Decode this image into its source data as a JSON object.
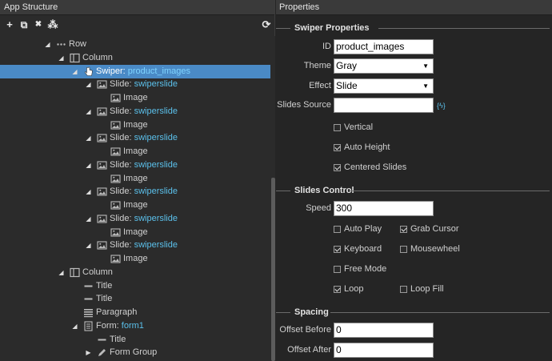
{
  "left_panel": {
    "title": "App Structure",
    "toolbar": [
      {
        "id": "add",
        "icon": "plus-icon",
        "glyph": "+"
      },
      {
        "id": "duplicate",
        "icon": "copy-icon",
        "glyph": "⧉"
      },
      {
        "id": "delete",
        "icon": "delete-x-icon",
        "glyph": "✖"
      },
      {
        "id": "components",
        "icon": "cubes-icon",
        "glyph": "⁂"
      },
      {
        "id": "refresh",
        "icon": "refresh-icon",
        "glyph": "⟳"
      }
    ],
    "tree": [
      {
        "depth": 0,
        "arrow": "expanded",
        "icon": "dots-icon",
        "type": "Row",
        "name": ""
      },
      {
        "depth": 1,
        "arrow": "expanded",
        "icon": "column-icon",
        "type": "Column",
        "name": ""
      },
      {
        "depth": 2,
        "arrow": "expanded",
        "icon": "hand-pointer-icon",
        "type": "Swiper: ",
        "name": "product_images",
        "selected": true
      },
      {
        "depth": 3,
        "arrow": "expanded",
        "icon": "image-icon",
        "type": "Slide: ",
        "name": "swiperslide"
      },
      {
        "depth": 4,
        "arrow": "none",
        "icon": "image-icon",
        "type": "Image",
        "name": ""
      },
      {
        "depth": 3,
        "arrow": "expanded",
        "icon": "image-icon",
        "type": "Slide: ",
        "name": "swiperslide"
      },
      {
        "depth": 4,
        "arrow": "none",
        "icon": "image-icon",
        "type": "Image",
        "name": ""
      },
      {
        "depth": 3,
        "arrow": "expanded",
        "icon": "image-icon",
        "type": "Slide: ",
        "name": "swiperslide"
      },
      {
        "depth": 4,
        "arrow": "none",
        "icon": "image-icon",
        "type": "Image",
        "name": ""
      },
      {
        "depth": 3,
        "arrow": "expanded",
        "icon": "image-icon",
        "type": "Slide: ",
        "name": "swiperslide"
      },
      {
        "depth": 4,
        "arrow": "none",
        "icon": "image-icon",
        "type": "Image",
        "name": ""
      },
      {
        "depth": 3,
        "arrow": "expanded",
        "icon": "image-icon",
        "type": "Slide: ",
        "name": "swiperslide"
      },
      {
        "depth": 4,
        "arrow": "none",
        "icon": "image-icon",
        "type": "Image",
        "name": ""
      },
      {
        "depth": 3,
        "arrow": "expanded",
        "icon": "image-icon",
        "type": "Slide: ",
        "name": "swiperslide"
      },
      {
        "depth": 4,
        "arrow": "none",
        "icon": "image-icon",
        "type": "Image",
        "name": ""
      },
      {
        "depth": 3,
        "arrow": "expanded",
        "icon": "image-icon",
        "type": "Slide: ",
        "name": "swiperslide"
      },
      {
        "depth": 4,
        "arrow": "none",
        "icon": "image-icon",
        "type": "Image",
        "name": ""
      },
      {
        "depth": 1,
        "arrow": "expanded",
        "icon": "column-icon",
        "type": "Column",
        "name": ""
      },
      {
        "depth": 2,
        "arrow": "none",
        "icon": "title-dash-icon",
        "type": "Title",
        "name": ""
      },
      {
        "depth": 2,
        "arrow": "none",
        "icon": "title-dash-icon",
        "type": "Title",
        "name": ""
      },
      {
        "depth": 2,
        "arrow": "none",
        "icon": "paragraph-icon",
        "type": "Paragraph",
        "name": ""
      },
      {
        "depth": 2,
        "arrow": "expanded",
        "icon": "form-icon",
        "type": "Form: ",
        "name": "form1"
      },
      {
        "depth": 3,
        "arrow": "none",
        "icon": "title-dash-icon",
        "type": "Title",
        "name": ""
      },
      {
        "depth": 3,
        "arrow": "collapsed",
        "icon": "pencil-icon",
        "type": "Form Group",
        "name": ""
      }
    ]
  },
  "right_panel": {
    "title": "Properties",
    "swiper_properties": {
      "section_title": "Swiper Properties",
      "id_label": "ID",
      "id_value": "product_images",
      "theme_label": "Theme",
      "theme_value": "Gray",
      "effect_label": "Effect",
      "effect_value": "Slide",
      "slides_source_label": "Slides Source",
      "slides_source_value": "",
      "bind_glyph": "{ϟ}",
      "vertical_label": "Vertical",
      "vertical_checked": false,
      "auto_height_label": "Auto Height",
      "auto_height_checked": true,
      "centered_label": "Centered Slides",
      "centered_checked": true
    },
    "slides_control": {
      "section_title": "Slides Control",
      "speed_label": "Speed",
      "speed_value": "300",
      "auto_play_label": "Auto Play",
      "auto_play_checked": false,
      "grab_cursor_label": "Grab Cursor",
      "grab_cursor_checked": true,
      "keyboard_label": "Keyboard",
      "keyboard_checked": true,
      "mousewheel_label": "Mousewheel",
      "mousewheel_checked": false,
      "free_mode_label": "Free Mode",
      "free_mode_checked": false,
      "loop_label": "Loop",
      "loop_checked": true,
      "loop_fill_label": "Loop Fill",
      "loop_fill_checked": false
    },
    "spacing": {
      "section_title": "Spacing",
      "offset_before_label": "Offset Before",
      "offset_before_value": "0",
      "offset_after_label": "Offset After",
      "offset_after_value": "0"
    }
  },
  "colors": {
    "selection": "#4a8ac6",
    "name_accent": "#5bc0eb",
    "panel_bg": "#2b2b2b"
  }
}
